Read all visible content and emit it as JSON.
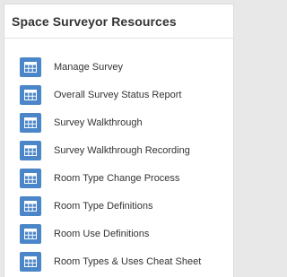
{
  "panel": {
    "title": "Space Surveyor Resources"
  },
  "resources": [
    {
      "label": "Manage Survey",
      "icon": "table-grid-icon"
    },
    {
      "label": "Overall Survey Status Report",
      "icon": "table-grid-icon"
    },
    {
      "label": "Survey Walkthrough",
      "icon": "table-grid-icon"
    },
    {
      "label": "Survey Walkthrough Recording",
      "icon": "table-grid-icon"
    },
    {
      "label": "Room Type Change Process",
      "icon": "table-grid-icon"
    },
    {
      "label": "Room Type Definitions",
      "icon": "table-grid-icon"
    },
    {
      "label": "Room Use Definitions",
      "icon": "table-grid-icon"
    },
    {
      "label": "Room Types & Uses Cheat Sheet",
      "icon": "table-grid-icon"
    }
  ],
  "colors": {
    "icon_background": "#4a86c8",
    "text": "#333333",
    "page_background": "#e8e8e8"
  }
}
